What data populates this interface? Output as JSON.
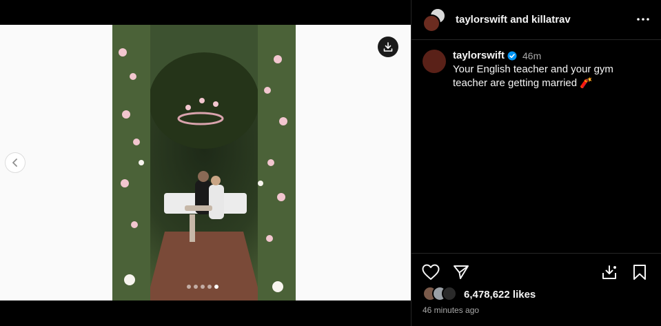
{
  "header": {
    "user1": "taylorswift",
    "connector": "and",
    "user2": "killatrav"
  },
  "caption": {
    "username": "taylorswift",
    "time": "46m",
    "text": "Your English teacher and your gym teacher are getting married 🧨"
  },
  "media": {
    "carousel_dots": 5,
    "active_dot": 5
  },
  "stats": {
    "likes": "6,478,622 likes",
    "posted": "46 minutes ago"
  },
  "icons": {
    "prev": "chevron-left-icon",
    "download": "download-icon",
    "more": "more-options-icon",
    "like": "heart-icon",
    "share": "paper-plane-icon",
    "save_media": "save-download-icon",
    "bookmark": "bookmark-icon",
    "verified": "verified-badge-icon"
  },
  "colors": {
    "background": "#000000",
    "verified": "#0095f6",
    "muted_text": "#a8a8a8",
    "divider": "#262626"
  }
}
